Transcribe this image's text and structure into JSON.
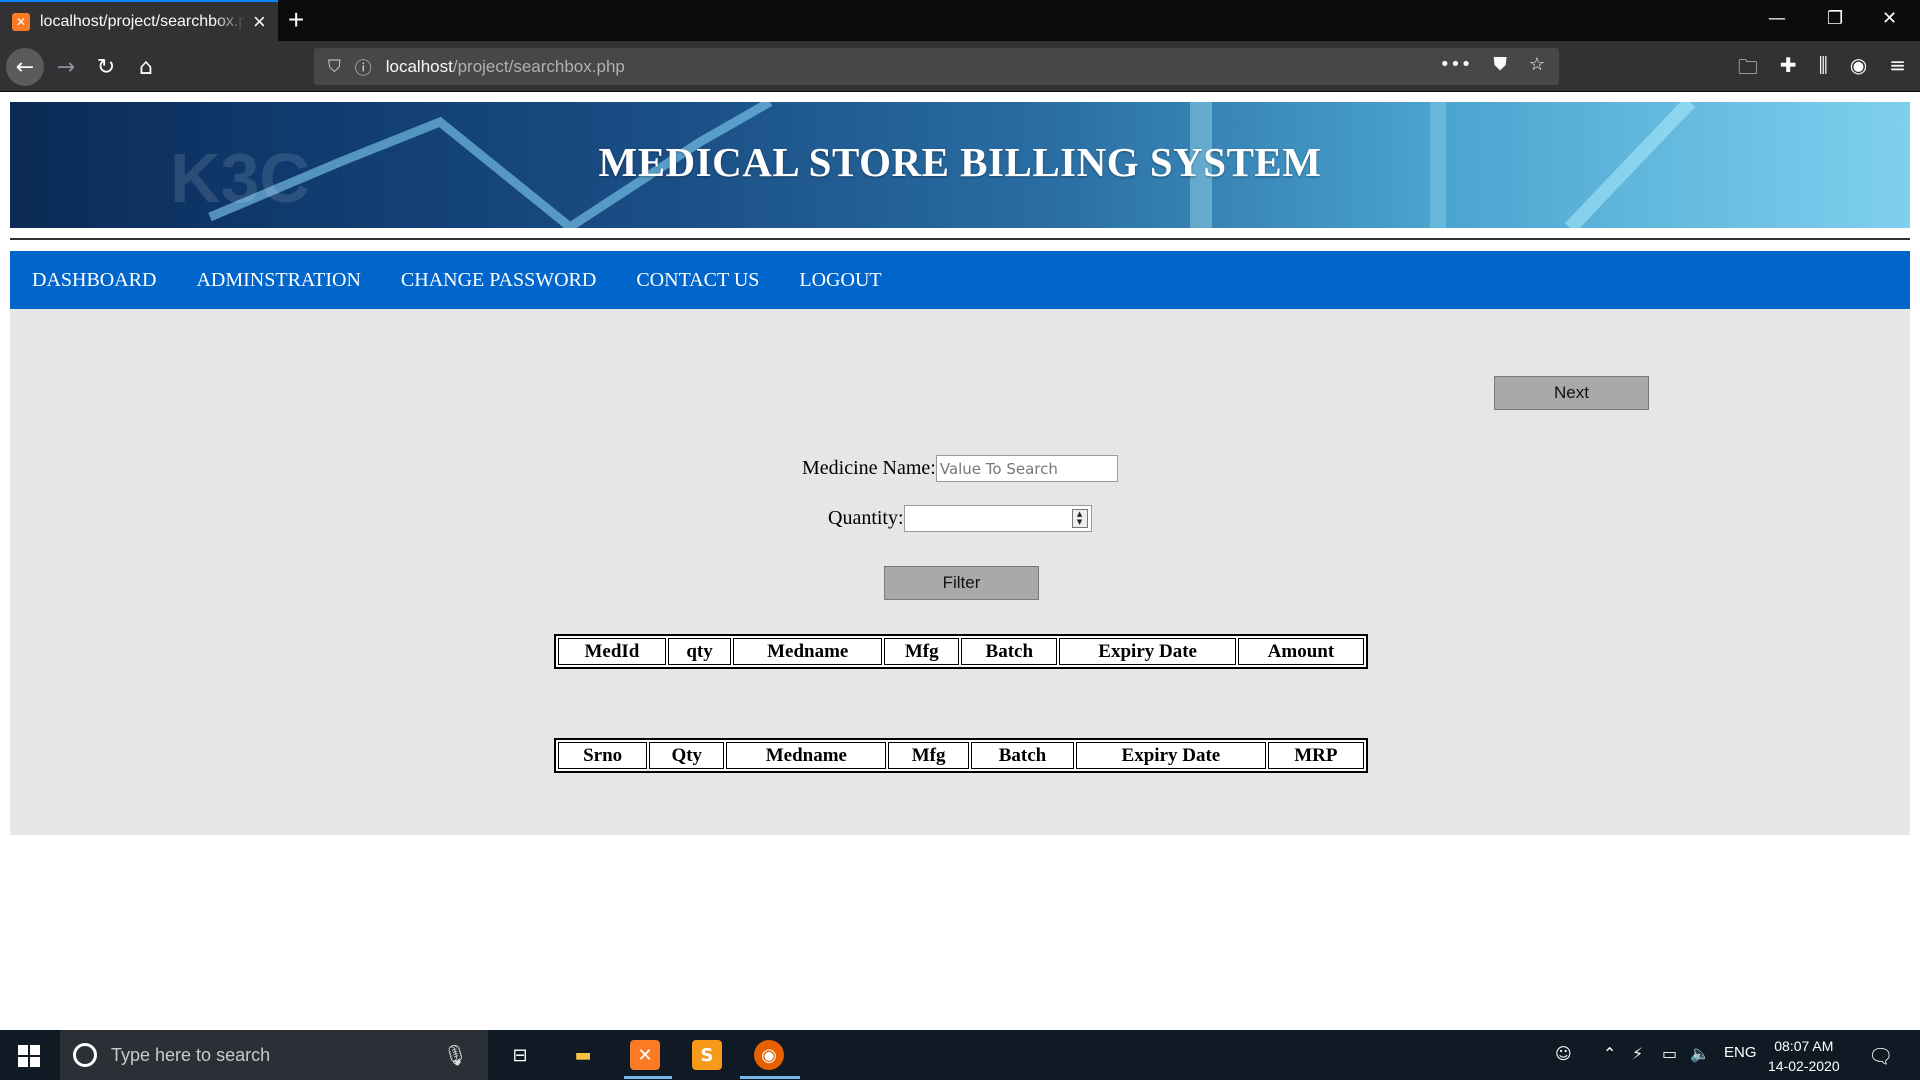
{
  "browser": {
    "tab_title": "localhost/project/searchbox.php",
    "url_host": "localhost",
    "url_path": "/project/searchbox.php"
  },
  "page": {
    "banner_title": "MEDICAL STORE BILLING SYSTEM",
    "menu": [
      "DASHBOARD",
      "ADMINSTRATION",
      "CHANGE PASSWORD",
      "CONTACT US",
      "LOGOUT"
    ],
    "next_label": "Next",
    "medicine_label": "Medicine Name:",
    "medicine_placeholder": "Value To Search",
    "quantity_label": "Quantity:",
    "filter_label": "Filter",
    "top_table_headers": [
      "MedId",
      "qty",
      "Medname",
      "Mfg",
      "Batch",
      "Expiry Date",
      "Amount"
    ],
    "bottom_table_headers": [
      "Srno",
      "Qty",
      "Medname",
      "Mfg",
      "Batch",
      "Expiry Date",
      "MRP"
    ]
  },
  "taskbar": {
    "search_placeholder": "Type here to search",
    "language": "ENG",
    "time": "08:07 AM",
    "date": "14-02-2020"
  },
  "colors": {
    "menu_bg": "#0066cc",
    "content_bg": "#e6e6e6",
    "button_bg": "#a9a9a9"
  }
}
